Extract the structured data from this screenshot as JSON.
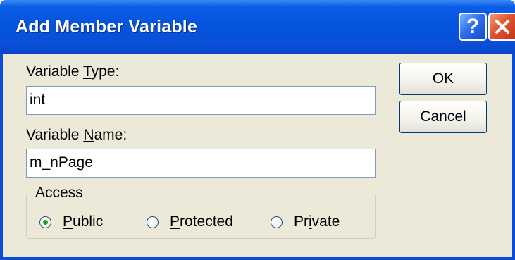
{
  "window": {
    "title": "Add Member Variable",
    "help_glyph": "?",
    "close_glyph": "✕"
  },
  "fields": {
    "type_label_pre": "Variable ",
    "type_label_key": "T",
    "type_label_post": "ype:",
    "type_value": "int",
    "name_label_pre": "Variable ",
    "name_label_key": "N",
    "name_label_post": "ame:",
    "name_value": "m_nPage"
  },
  "access": {
    "legend": "Access",
    "options": [
      {
        "key": "P",
        "rest": "ublic",
        "pre": "",
        "checked": true
      },
      {
        "pre": "",
        "key": "P",
        "rest": "rotected",
        "checked": false
      },
      {
        "pre": "Pr",
        "key": "i",
        "rest": "vate",
        "checked": false
      }
    ]
  },
  "buttons": {
    "ok": "OK",
    "cancel": "Cancel"
  },
  "colors": {
    "titlebar": "#0553dc",
    "face": "#ece9d8",
    "close": "#e1532f"
  }
}
